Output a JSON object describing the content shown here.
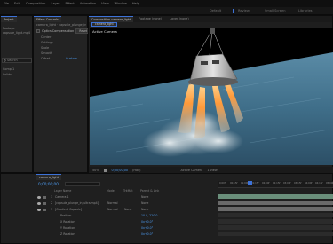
{
  "menu": [
    "File",
    "Edit",
    "Composition",
    "Layer",
    "Effect",
    "Animation",
    "View",
    "Window",
    "Help"
  ],
  "workspaces": [
    {
      "label": "Default",
      "active": false
    },
    {
      "label": "Review",
      "active": false
    },
    {
      "label": "Small Screen",
      "active": false
    },
    {
      "label": "Libraries",
      "active": false
    }
  ],
  "project_panel": {
    "tab": "Project",
    "item_title": "Footage",
    "item_sub": "capsule_light.mp4",
    "search": "Search",
    "folders": [
      "Comp 1",
      "Solids"
    ]
  },
  "effect_controls": {
    "tab_label": "Effect Controls",
    "layer_label": "camera_light",
    "breadcrumb": "camera_light · capsule_plunge_in_ultra.mp4",
    "effect_name": "Optics Compensation",
    "reset_label": "Reset",
    "rows": [
      "Center",
      "Settings",
      "Scale",
      "Smooth",
      "Offset"
    ],
    "custom_label": "Custom"
  },
  "viewer": {
    "tabs": [
      {
        "label": "Composition camera_light",
        "active": true
      },
      {
        "label": "Footage (none)",
        "active": false
      },
      {
        "label": "Layer (none)",
        "active": false
      }
    ],
    "comp_chip": "camera_light",
    "active_camera": "Active Camera",
    "zoom": "50%",
    "timecode": "0;00;00;00",
    "resolution": "(Half)",
    "camera_select": "Active Camera",
    "view_select": "1 View"
  },
  "timeline": {
    "tab": "camera_light",
    "timecode": "0;00;00;00",
    "columns": {
      "name": "Layer Name",
      "mode": "Mode",
      "trkmat": "TrkMat",
      "parent": "Parent & Link"
    },
    "layers": [
      {
        "num": "1",
        "name": "Camera 1",
        "mode": "",
        "trkmat": "",
        "parent": "None"
      },
      {
        "num": "2",
        "name": "[capsule_plunge_in_ultra.mp4]",
        "mode": "Normal",
        "trkmat": "",
        "parent": "None"
      },
      {
        "num": "3",
        "name": "[Gradient Capsule]",
        "mode": "Normal",
        "trkmat": "None",
        "parent": "None"
      },
      {
        "num": "",
        "name": "Position",
        "mode": "",
        "trkmat": "",
        "parent": "10.0,-220.0"
      },
      {
        "num": "",
        "name": "X Rotation",
        "mode": "",
        "trkmat": "",
        "parent": "0x+0.0°"
      },
      {
        "num": "",
        "name": "Y Rotation",
        "mode": "",
        "trkmat": "",
        "parent": "0x+0.0°"
      },
      {
        "num": "",
        "name": "Z Rotation",
        "mode": "",
        "trkmat": "",
        "parent": "0x+0.0°"
      }
    ],
    "ruler": [
      "0;00f",
      "00;15f",
      "01;00f",
      "01;15f",
      "02;00f",
      "02;15f",
      "03;00f",
      "03;15f",
      "04;00f",
      "04;15f",
      "05;00f"
    ]
  },
  "colors": {
    "accent": "#3d72d8",
    "timeline_bar_gray": "#6a6a6a",
    "timeline_bar_green": "#6a8f7b",
    "sky": "#000000",
    "water": "#4a7d99"
  },
  "icons": [
    "play-icon",
    "camera-icon",
    "eye-icon",
    "lock-icon",
    "search-icon",
    "fullscreen-icon"
  ]
}
